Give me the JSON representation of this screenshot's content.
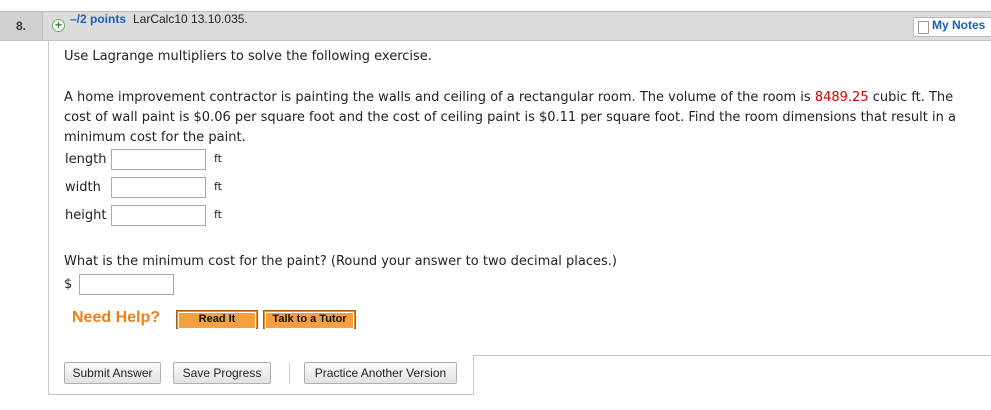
{
  "header": {
    "question_number": "8.",
    "plus_icon": "plus-circle-icon",
    "points": "–/2 points",
    "question_id": "LarCalc10 13.10.035.",
    "my_notes": "My Notes",
    "colors": {
      "link": "#1d5fb8",
      "header_bg": "#dcdcdc"
    }
  },
  "body": {
    "instruction": "Use Lagrange multipliers to solve the following exercise.",
    "problem": {
      "before_volume": "A home improvement contractor is painting the walls and ceiling of a rectangular room. The volume of the room is ",
      "volume": "8489.25",
      "after_volume": " cubic ft. The cost of wall paint is $0.06 per square foot and the cost of ceiling paint is $0.11 per square foot. Find the room dimensions that result in a minimum cost for the paint."
    },
    "answers": [
      {
        "label": "length",
        "value": "",
        "unit": "ft"
      },
      {
        "label": "width",
        "value": "",
        "unit": "ft"
      },
      {
        "label": "height",
        "value": "",
        "unit": "ft"
      }
    ],
    "cost_question": "What is the minimum cost for the paint? (Round your answer to two decimal places.)",
    "currency_symbol": "$",
    "cost_value": ""
  },
  "help": {
    "label": "Need Help?",
    "read_it": "Read It",
    "talk_to_tutor": "Talk to a Tutor",
    "accent_color": "#f07f1a"
  },
  "actions": {
    "submit": "Submit Answer",
    "save": "Save Progress",
    "practice": "Practice Another Version"
  }
}
